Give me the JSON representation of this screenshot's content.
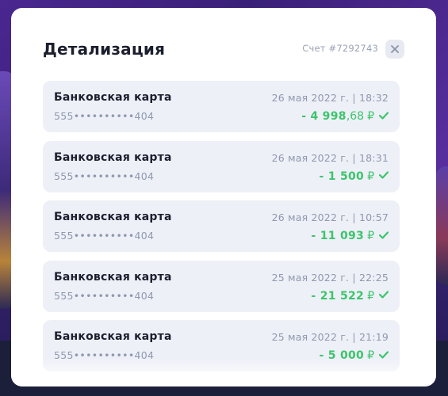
{
  "modal": {
    "title": "Детализация",
    "account": "Счет #7292743",
    "close_icon": "close-icon"
  },
  "colors": {
    "amount": "#3cc46b",
    "row_bg": "#edf0f7",
    "title": "#1b1f2e",
    "muted": "#8f98ae"
  },
  "transactions": [
    {
      "title": "Банковская карта",
      "card": "555••••••••••404",
      "date": "26 мая 2022 г. | 18:32",
      "amount": "- 4 998",
      "cents": ",68",
      "currency": "₽",
      "status_icon": "check-icon"
    },
    {
      "title": "Банковская карта",
      "card": "555••••••••••404",
      "date": "26 мая 2022 г. | 18:31",
      "amount": "- 1 500",
      "cents": "",
      "currency": "₽",
      "status_icon": "check-icon"
    },
    {
      "title": "Банковская карта",
      "card": "555••••••••••404",
      "date": "26 мая 2022 г. | 10:57",
      "amount": "- 11 093",
      "cents": "",
      "currency": "₽",
      "status_icon": "check-icon"
    },
    {
      "title": "Банковская карта",
      "card": "555••••••••••404",
      "date": "25 мая 2022 г. | 22:25",
      "amount": "- 21 522",
      "cents": "",
      "currency": "₽",
      "status_icon": "check-icon"
    },
    {
      "title": "Банковская карта",
      "card": "555••••••••••404",
      "date": "25 мая 2022 г. | 21:19",
      "amount": "- 5 000",
      "cents": "",
      "currency": "₽",
      "status_icon": "check-icon"
    }
  ]
}
